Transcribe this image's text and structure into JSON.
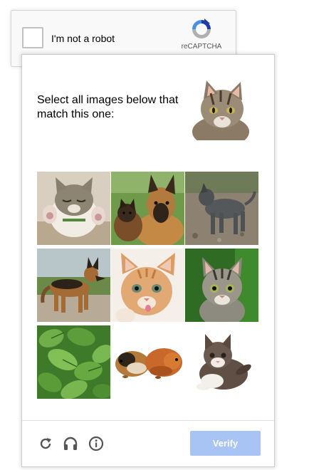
{
  "checkbox_widget": {
    "label": "I'm not a robot",
    "brand": "reCAPTCHA",
    "logo_icon": "recaptcha-logo-icon"
  },
  "challenge": {
    "prompt": "Select all images below that match this one:",
    "sample_image": "tabby-cat-photo",
    "tiles": [
      {
        "subject": "kitten-on-back-photo"
      },
      {
        "subject": "german-shepherd-with-puppy-photo"
      },
      {
        "subject": "grey-dog-on-dirt-photo"
      },
      {
        "subject": "german-shepherd-standing-photo"
      },
      {
        "subject": "ginger-kitten-photo"
      },
      {
        "subject": "tabby-kitten-photo"
      },
      {
        "subject": "green-leaves-photo"
      },
      {
        "subject": "two-guinea-pigs-photo"
      },
      {
        "subject": "fluffy-kitten-photo"
      }
    ],
    "footer": {
      "reload_icon": "reload-icon",
      "audio_icon": "headphones-icon",
      "info_icon": "info-icon",
      "verify_label": "Verify"
    }
  },
  "colors": {
    "verify_button": "#a7c4f5",
    "icon": "#555555",
    "logo_blue": "#1c3aa9",
    "logo_light_blue": "#4a90e2",
    "logo_grey": "#b0b0b0"
  }
}
